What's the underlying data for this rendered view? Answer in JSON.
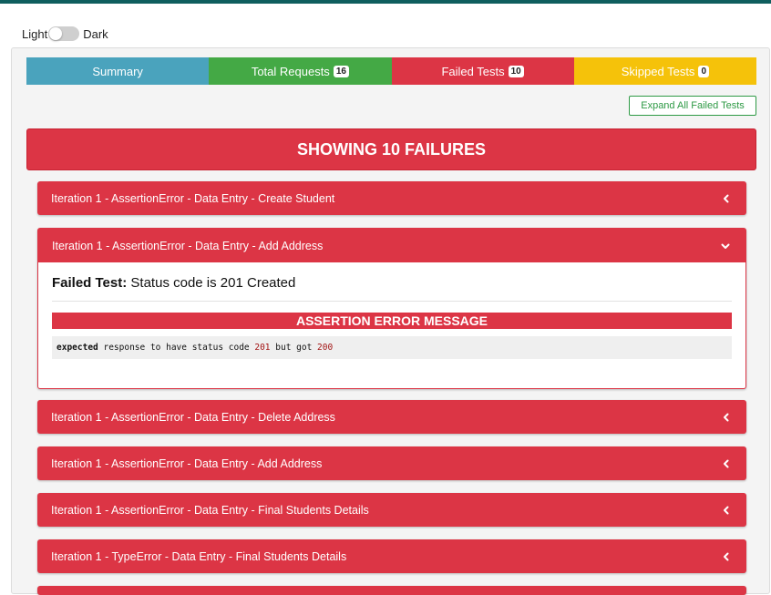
{
  "theme": {
    "light_label": "Light",
    "dark_label": "Dark"
  },
  "tabs": [
    {
      "label": "Summary",
      "badge": null,
      "color": "#4aa3bd"
    },
    {
      "label": "Total Requests",
      "badge": "16",
      "color": "#44a945"
    },
    {
      "label": "Failed Tests",
      "badge": "10",
      "color": "#dc3545"
    },
    {
      "label": "Skipped Tests",
      "badge": "0",
      "color": "#f5c20a"
    }
  ],
  "expand_button": "Expand All Failed Tests",
  "banner": "SHOWING 10 FAILURES",
  "failures": [
    {
      "title": "Iteration 1 - AssertionError - Data Entry - Create Student",
      "expanded": false
    },
    {
      "title": "Iteration 1 - AssertionError - Data Entry - Add Address",
      "expanded": true
    },
    {
      "title": "Iteration 1 - AssertionError - Data Entry - Delete Address",
      "expanded": false
    },
    {
      "title": "Iteration 1 - AssertionError - Data Entry - Add Address",
      "expanded": false
    },
    {
      "title": "Iteration 1 - AssertionError - Data Entry - Final Students Details",
      "expanded": false
    },
    {
      "title": "Iteration 1 - TypeError - Data Entry - Final Students Details",
      "expanded": false
    }
  ],
  "detail": {
    "failed_label": "Failed Test:",
    "failed_value": " Status code is 201 Created",
    "error_title": "ASSERTION ERROR MESSAGE",
    "msg_keyword": "expected",
    "msg_part1": " response to have status code ",
    "msg_num1": "201",
    "msg_part2": " but got ",
    "msg_num2": "200"
  }
}
